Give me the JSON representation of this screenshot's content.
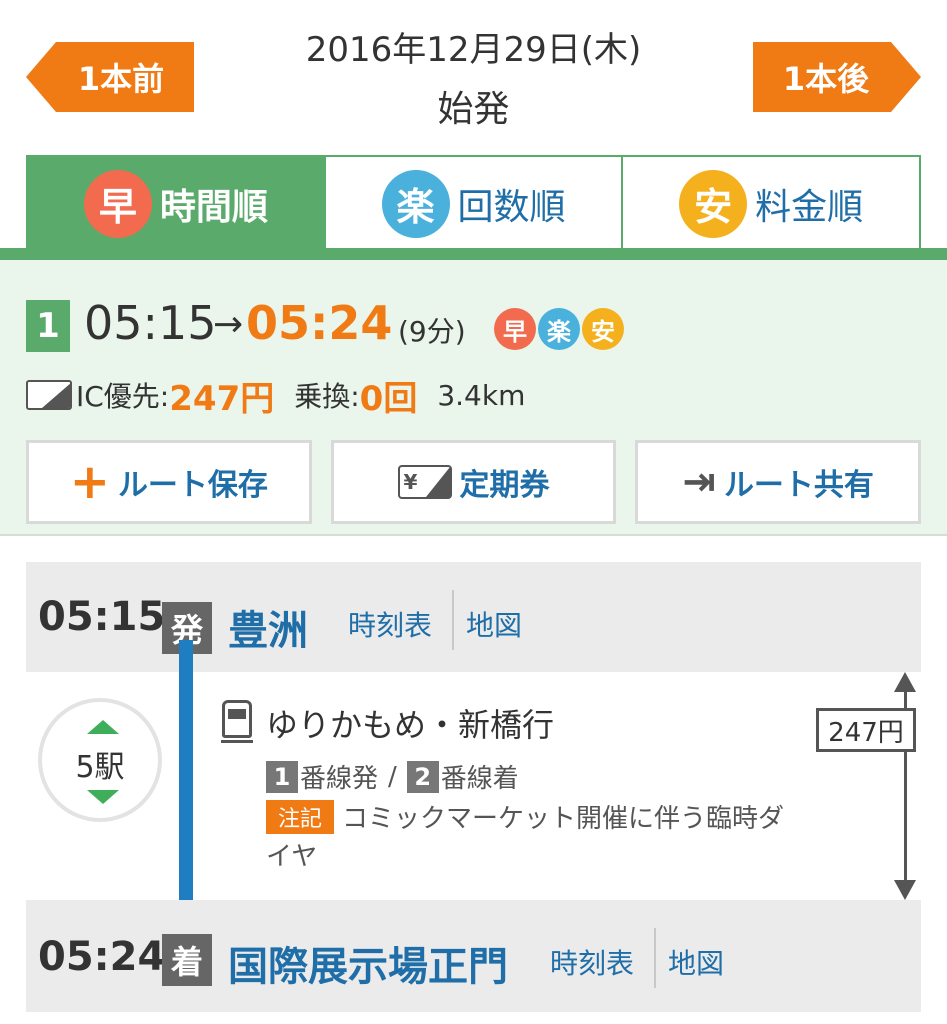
{
  "header": {
    "prev_label": "1本前",
    "next_label": "1本後",
    "date": "2016年12月29日(木)",
    "subtitle": "始発"
  },
  "tabs": [
    {
      "icon_char": "早",
      "icon_color": "#f26b4f",
      "label": "時間順",
      "active": true
    },
    {
      "icon_char": "楽",
      "icon_color": "#4ab0dc",
      "label": "回数順",
      "active": false
    },
    {
      "icon_char": "安",
      "icon_color": "#f4b11d",
      "label": "料金順",
      "active": false
    }
  ],
  "result": {
    "route_number": "1",
    "depart_time": "05:15",
    "arrow": "→",
    "arrive_time": "05:24",
    "duration": "(9分)",
    "badges": [
      {
        "char": "早",
        "color": "#f26b4f"
      },
      {
        "char": "楽",
        "color": "#4ab0dc"
      },
      {
        "char": "安",
        "color": "#f4b11d"
      }
    ],
    "ic_label": "IC優先:",
    "fare": "247円",
    "transfer_label": "乗換:",
    "transfers": "0回",
    "distance": "3.4km"
  },
  "actions": {
    "save_icon": "+",
    "save_label": "ルート保存",
    "pass_icon_text": "¥",
    "pass_label": "定期券",
    "share_icon": "⇥",
    "share_label": "ルート共有"
  },
  "departure": {
    "time": "05:15",
    "mark": "発",
    "station": "豊洲",
    "timetable_link": "時刻表",
    "map_link": "地図"
  },
  "segment": {
    "stops": "5駅",
    "line_name": "ゆりかもめ・新橋行",
    "platform_from_no": "1",
    "platform_from_text": "番線発",
    "platform_sep": "/",
    "platform_to_no": "2",
    "platform_to_text": "番線着",
    "notice_tag": "注記",
    "notice_text": "コミックマーケット開催に伴う臨時ダイヤ",
    "fare": "247円",
    "line_color": "#1f7ec1"
  },
  "arrival": {
    "time": "05:24",
    "mark": "着",
    "station": "国際展示場正門",
    "timetable_link": "時刻表",
    "map_link": "地図"
  },
  "colors": {
    "accent_orange": "#f07a14",
    "green": "#5aab6b",
    "link_blue": "#1f6ea8"
  }
}
